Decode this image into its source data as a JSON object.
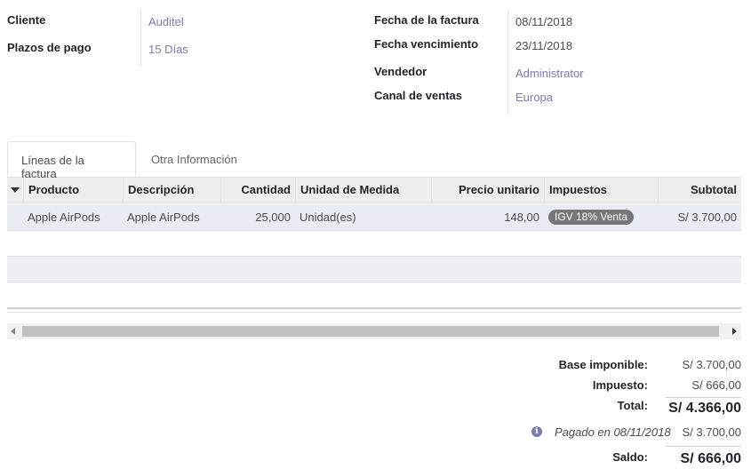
{
  "header": {
    "left": [
      {
        "label": "Cliente",
        "value": "Auditel"
      },
      {
        "label": "Plazos de pago",
        "value": "15 Días"
      }
    ],
    "right": [
      {
        "label": "Fecha de la factura",
        "value": "08/11/2018"
      },
      {
        "label": "Fecha vencimiento",
        "value": "23/11/2018"
      },
      {
        "label": "Vendedor",
        "value": "Administrator"
      },
      {
        "label": "Canal de ventas",
        "value": "Europa"
      }
    ]
  },
  "tabs": [
    {
      "label": "Líneas de la factura",
      "active": true
    },
    {
      "label": "Otra Información",
      "active": false
    }
  ],
  "table": {
    "columns": [
      "Producto",
      "Descripción",
      "Cantidad",
      "Unidad de Medida",
      "Precio unitario",
      "Impuestos",
      "Subtotal"
    ],
    "rows": [
      {
        "producto": "Apple AirPods",
        "descripcion": "Apple AirPods",
        "cantidad": "25,000",
        "unidad": "Unidad(es)",
        "precio": "148,00",
        "impuesto": "IGV 18% Venta",
        "subtotal": "S/ 3.700,00"
      }
    ]
  },
  "totals": {
    "base_label": "Base imponible:",
    "base_value": "S/ 3.700,00",
    "impuesto_label": "Impuesto:",
    "impuesto_value": "S/ 666,00",
    "total_label": "Total:",
    "total_value": "S/ 4.366,00",
    "payment_text": "Pagado en 08/11/2018",
    "payment_value": "S/ 3.700,00",
    "saldo_label": "Saldo:",
    "saldo_value": "S/ 666,00"
  },
  "colors": {
    "link": "#7c7bad",
    "badge": "#777777",
    "header_bg": "#eeeeee"
  }
}
